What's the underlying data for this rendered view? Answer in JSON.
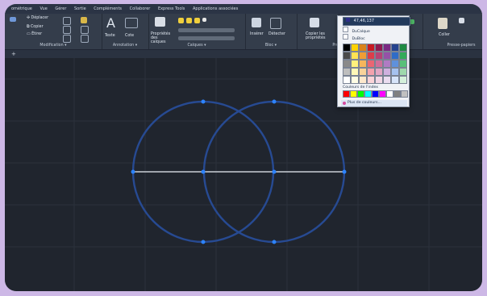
{
  "menu": {
    "items": [
      "ométrique",
      "Vue",
      "Gérer",
      "Sortie",
      "Compléments",
      "Collaborer",
      "Express Tools",
      "Applications associées"
    ]
  },
  "ribbon": {
    "modify": {
      "title": "Modification ▾",
      "items": [
        "Déplacer",
        "Copier",
        "Étirer"
      ]
    },
    "annotation": {
      "title": "Annotation ▾",
      "items": [
        "Texte",
        "Cote"
      ]
    },
    "layers": {
      "title": "Calques ▾",
      "items": [
        "Propriétés des calques"
      ]
    },
    "block": {
      "title": "Bloc ▾",
      "items": [
        "Insérer",
        "Détecter"
      ]
    },
    "properties": {
      "title": "Pro",
      "items": [
        "Copier les propriétés"
      ]
    },
    "utilities": {
      "title": "Utilitaires ▾",
      "items": [
        "Mesurer"
      ]
    },
    "clipboard": {
      "title": "Presse-papiers",
      "items": [
        "Coller"
      ]
    }
  },
  "colorDropdown": {
    "selected": "47,46,137",
    "options": [
      "DuCalque",
      "DuBloc"
    ],
    "indexLabel": "Couleurs de l'index",
    "more": "Plus de couleurs..."
  },
  "colors": {
    "accent": "#2d83ff",
    "circle": "#274a92",
    "line": "#c9ced6",
    "background": "#20252e"
  }
}
